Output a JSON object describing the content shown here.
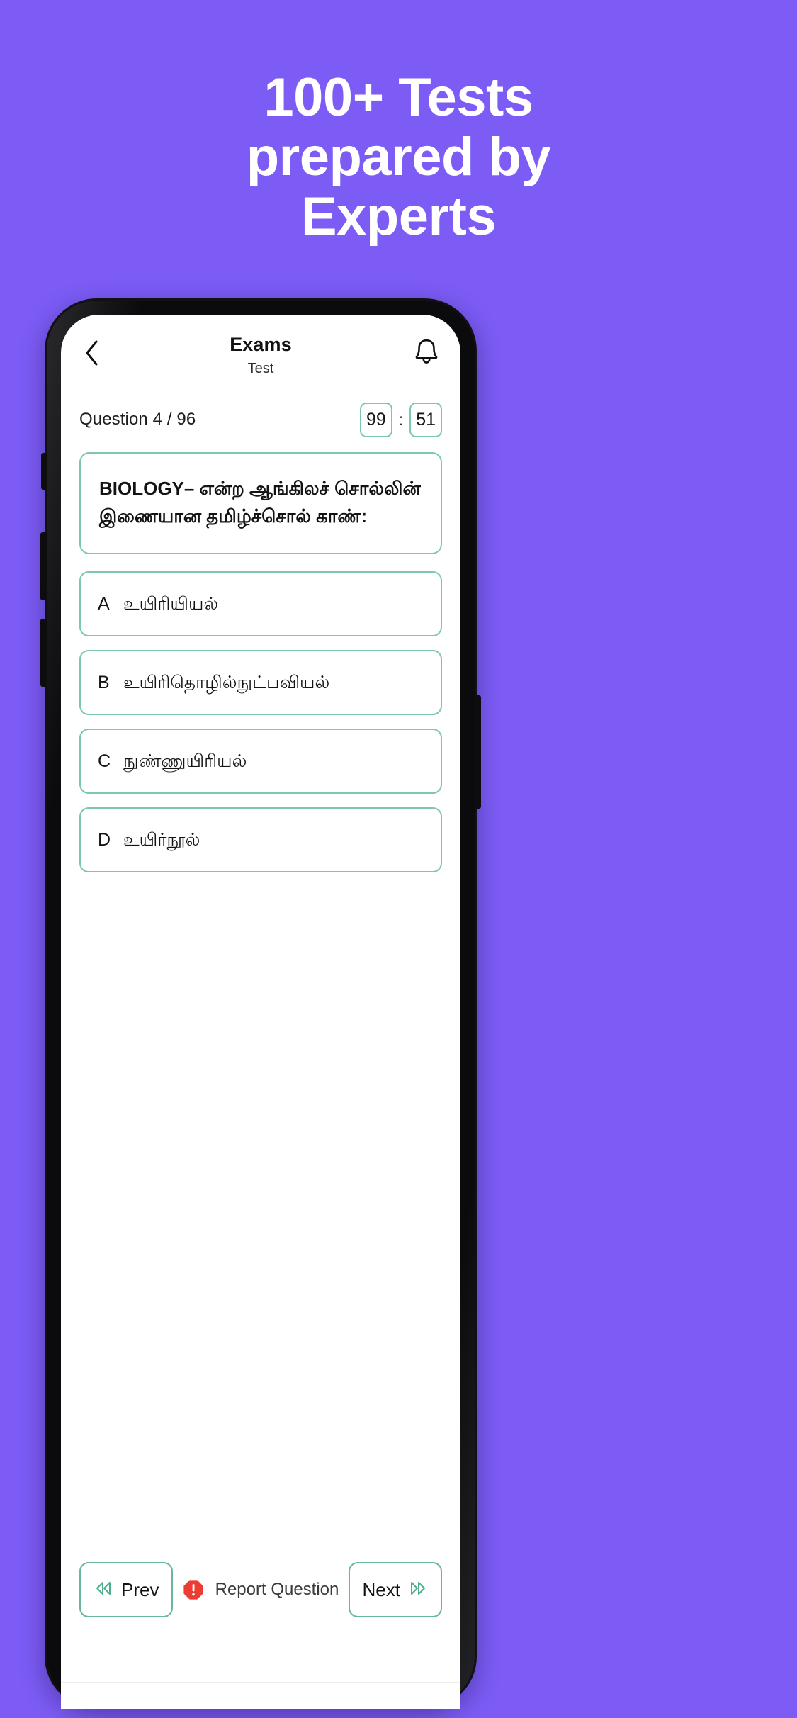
{
  "promo": {
    "headline": "100+ Tests\nprepared by\nExperts",
    "background_color": "#7c5cf5",
    "headline_color": "#ffffff"
  },
  "theme": {
    "accent_border": "#7fc6ae",
    "accent_icon": "#4dad8d",
    "alert_red": "#ee3b33",
    "text_primary": "#131313",
    "screen_background": "#ffffff",
    "phone_body": "#111113"
  },
  "app": {
    "header": {
      "back_icon": "chevron-left-icon",
      "title": "Exams",
      "subtitle": "Test",
      "notification_icon": "bell-icon"
    },
    "meta": {
      "question_counter": "Question 4 / 96",
      "current_question": 4,
      "total_questions": 96,
      "timer": {
        "minutes": "99",
        "separator": ":",
        "seconds": "51"
      }
    },
    "question": {
      "text": "BIOLOGY– என்ற ஆங்கிலச் சொல்லின் இணையான தமிழ்ச்சொல் காண்:"
    },
    "options": [
      {
        "key": "A",
        "text": "உயிரியியல்"
      },
      {
        "key": "B",
        "text": "உயிரிதொழில்நுட்பவியல்"
      },
      {
        "key": "C",
        "text": "நுண்ணுயிரியல்"
      },
      {
        "key": "D",
        "text": "உயிர்நூல்"
      }
    ],
    "bottom_bar": {
      "prev_label": "Prev",
      "prev_icon": "chevron-double-left-icon",
      "report_label": "Report Question",
      "report_icon": "alert-octagon-icon",
      "next_label": "Next",
      "next_icon": "chevron-double-right-icon"
    }
  }
}
